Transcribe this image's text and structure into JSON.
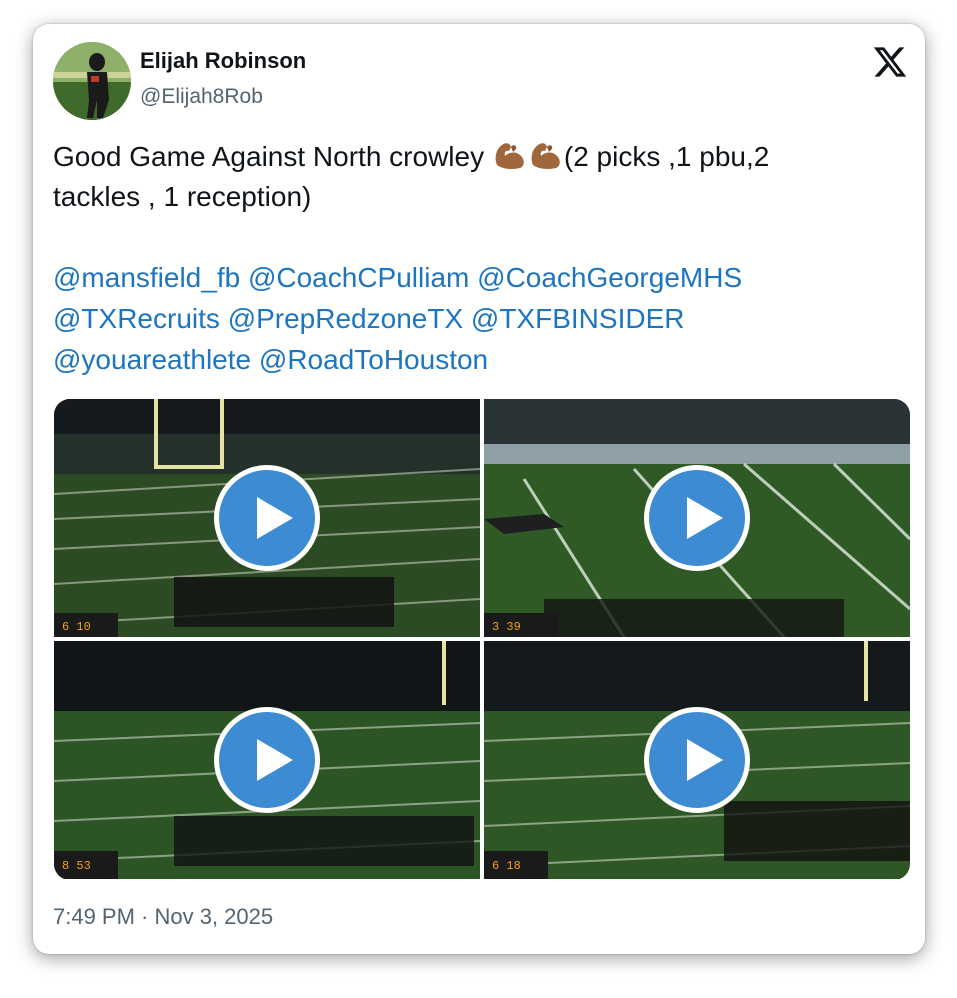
{
  "author": {
    "name": "Elijah Robinson",
    "handle": "@Elijah8Rob"
  },
  "tweet": {
    "line1_before": "Good Game Against North crowley ",
    "line1_after": "(2 picks ,1 pbu,2",
    "line2": "tackles , 1 reception)",
    "emoji": [
      "flexed-biceps-medium-dark-skin",
      "flexed-biceps-medium-dark-skin"
    ],
    "mentions": [
      [
        "@mansfield_fb",
        "@CoachCPulliam",
        "@CoachGeorgeMHS"
      ],
      [
        "@TXRecruits",
        "@PrepRedzoneTX",
        "@TXFBINSIDER"
      ],
      [
        "@youareathlete",
        "@RoadToHouston"
      ]
    ]
  },
  "media": [
    {
      "type": "video",
      "play_icon": "play-icon",
      "scoreboard": "6 10"
    },
    {
      "type": "video",
      "play_icon": "play-icon",
      "scoreboard": "3 39"
    },
    {
      "type": "video",
      "play_icon": "play-icon",
      "scoreboard": "8 53"
    },
    {
      "type": "video",
      "play_icon": "play-icon",
      "scoreboard": "6 18"
    }
  ],
  "timestamp": "7:49 PM · Nov 3, 2025",
  "colors": {
    "link": "#1d75c0",
    "text": "#0f1419",
    "muted": "#536471",
    "play": "#3d8bd3",
    "field": "#2f5a26"
  },
  "logo": "x-logo"
}
